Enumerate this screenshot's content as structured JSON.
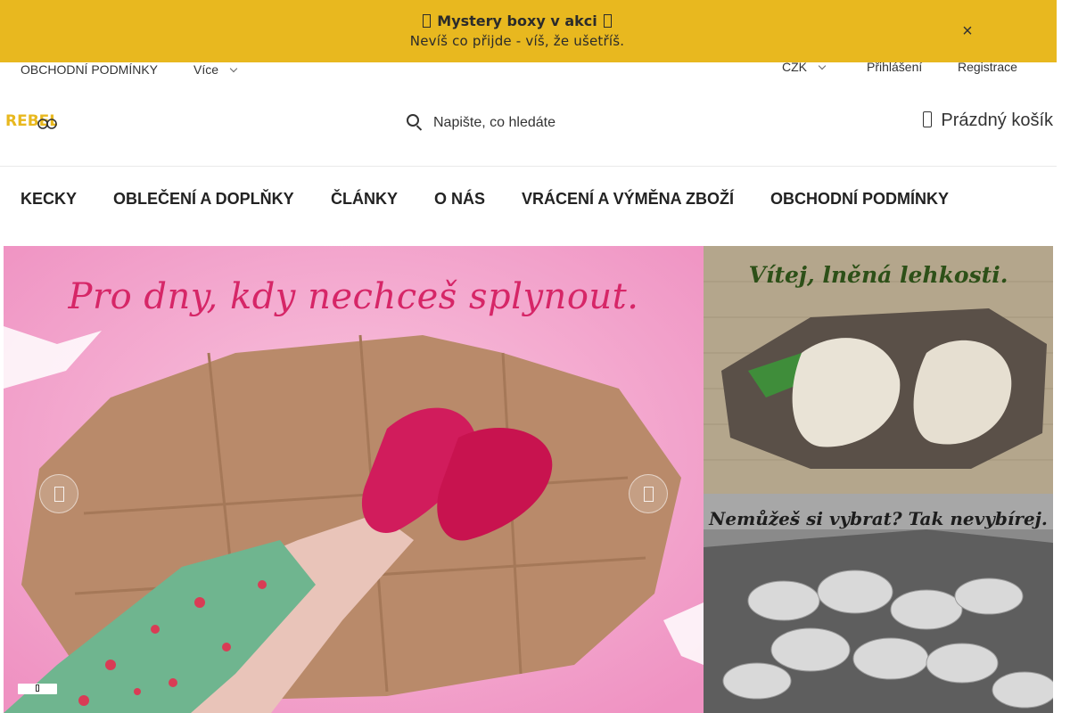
{
  "promo": {
    "title": "Mystery boxy v akci",
    "subtitle": "Nevíš co přijde - víš, že ušetříš.",
    "close_label": "×"
  },
  "toprow": {
    "terms_link": "OBCHODNÍ PODMÍNKY",
    "more_label": "Více",
    "currency": "CZK",
    "login": "Přihlášení",
    "register": "Registrace"
  },
  "header": {
    "logo_text": "REBEL",
    "search_placeholder": "Napište, co hledáte",
    "cart_label": "Prázdný košík"
  },
  "nav": {
    "items": [
      {
        "label": "KECKY"
      },
      {
        "label": "OBLEČENÍ A DOPLŇKY"
      },
      {
        "label": "ČLÁNKY"
      },
      {
        "label": "O NÁS"
      },
      {
        "label": "VRÁCENÍ A VÝMĚNA ZBOŽÍ"
      },
      {
        "label": "OBCHODNÍ PODMÍNKY"
      }
    ]
  },
  "hero": {
    "title": "Pro dny, kdy nechceš splynout."
  },
  "banners": {
    "banner1_title": "Vítej, lněná lehkosti.",
    "banner2_title": "Nemůžeš si vybrat? Tak nevybírej."
  },
  "colors": {
    "promo_bg": "#e8b81f",
    "hero_pink": "#f4a9cf",
    "hero_title": "#d62667",
    "shoe_red": "#d11c5c"
  }
}
